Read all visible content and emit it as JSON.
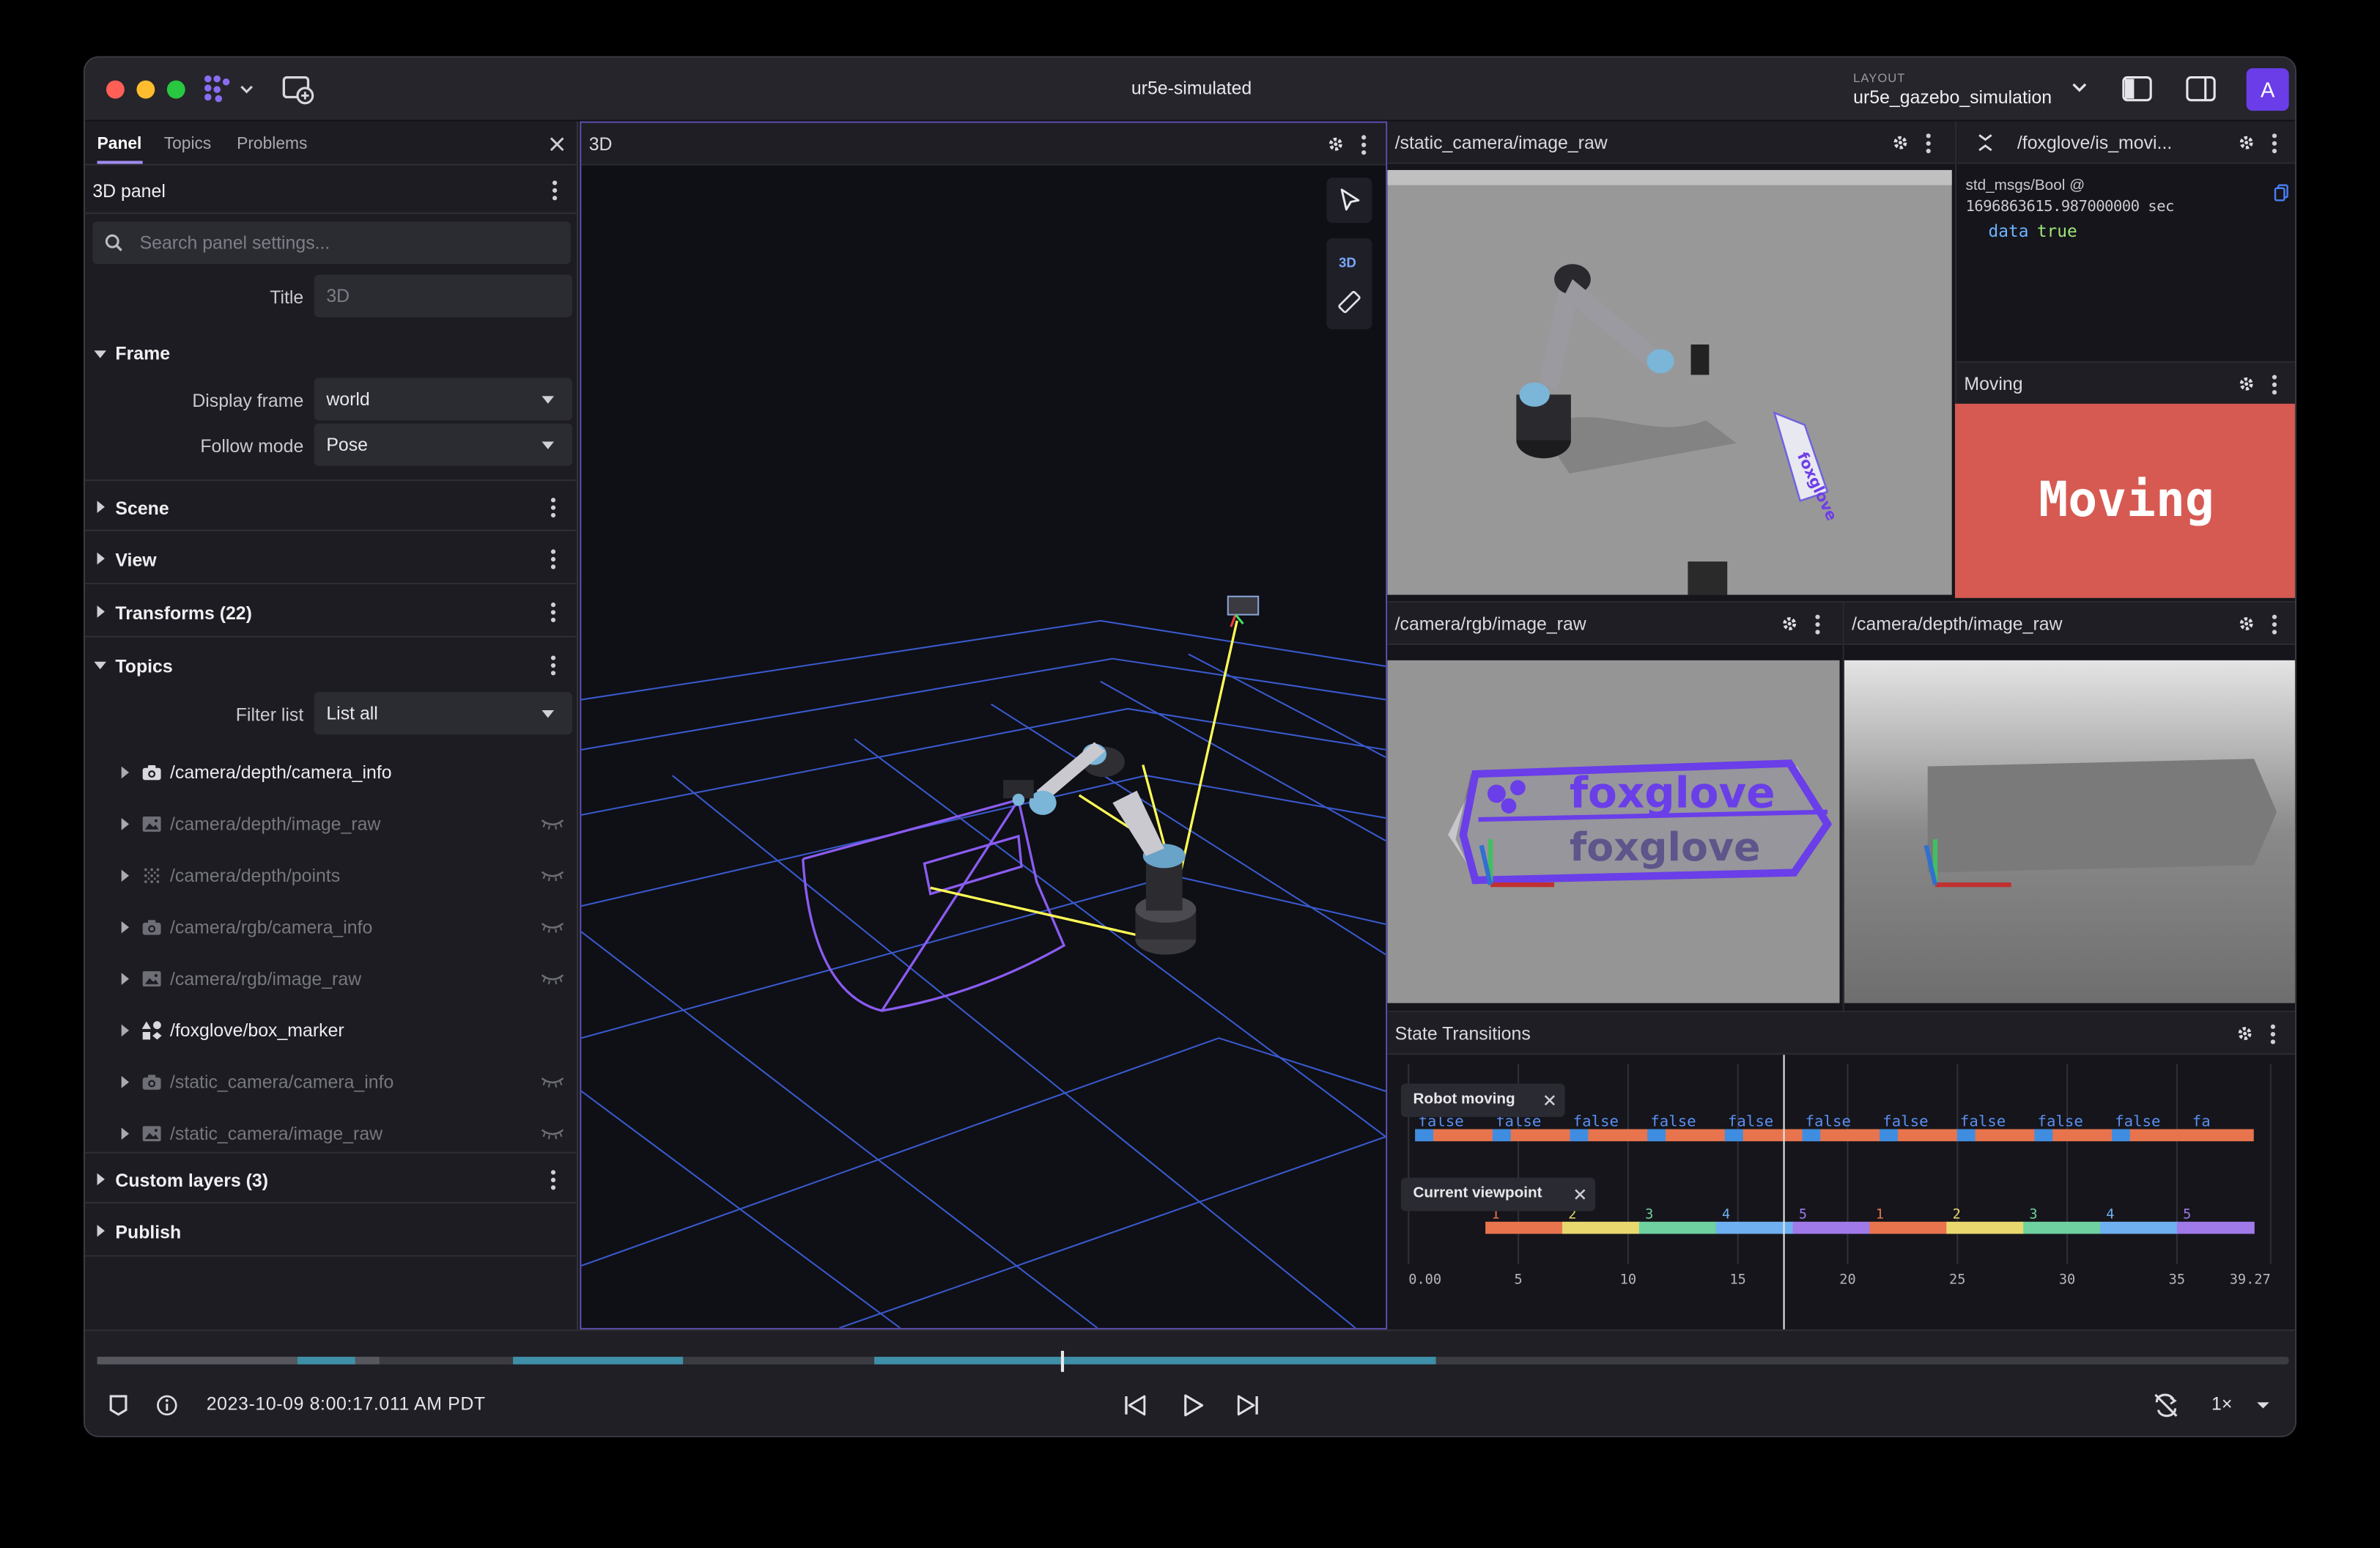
{
  "app": {
    "title": "ur5e-simulated",
    "layout_caption": "LAYOUT",
    "layout_name": "ur5e_gazebo_simulation",
    "avatar_letter": "A",
    "accent": "#6a3de8"
  },
  "sidebar": {
    "tabs": [
      "Panel",
      "Topics",
      "Problems"
    ],
    "panel_name": "3D panel",
    "search_placeholder": "Search panel settings...",
    "title_label": "Title",
    "title_placeholder": "3D",
    "sections": {
      "frame": "Frame",
      "scene": "Scene",
      "view": "View",
      "transforms": "Transforms (22)",
      "topics": "Topics",
      "custom_layers": "Custom layers (3)",
      "publish": "Publish"
    },
    "display_frame_label": "Display frame",
    "display_frame_value": "world",
    "follow_mode_label": "Follow mode",
    "follow_mode_value": "Pose",
    "filter_label": "Filter list",
    "filter_value": "List all",
    "topics": [
      {
        "name": "/camera/depth/camera_info",
        "icon": "camera-icon",
        "visible": true
      },
      {
        "name": "/camera/depth/image_raw",
        "icon": "image-icon",
        "visible": false
      },
      {
        "name": "/camera/depth/points",
        "icon": "points-icon",
        "visible": false
      },
      {
        "name": "/camera/rgb/camera_info",
        "icon": "camera-icon",
        "visible": false
      },
      {
        "name": "/camera/rgb/image_raw",
        "icon": "image-icon",
        "visible": false
      },
      {
        "name": "/foxglove/box_marker",
        "icon": "shapes-icon",
        "visible": true
      },
      {
        "name": "/static_camera/camera_info",
        "icon": "camera-icon",
        "visible": false
      },
      {
        "name": "/static_camera/image_raw",
        "icon": "image-icon",
        "visible": false
      }
    ]
  },
  "panels": {
    "three_d": {
      "title": "3D",
      "mode_label": "3D"
    },
    "static_camera": {
      "title": "/static_camera/image_raw"
    },
    "is_moving": {
      "title": "/foxglove/is_movi...",
      "message_type": "std_msgs/Bool @",
      "stamp": "1696863615.987000000 sec",
      "field": "data",
      "value": "true"
    },
    "moving": {
      "title": "Moving",
      "text": "Moving",
      "color": "#d65a52"
    },
    "rgb_camera": {
      "title": "/camera/rgb/image_raw",
      "box_text": "foxglove"
    },
    "depth_camera": {
      "title": "/camera/depth/image_raw"
    },
    "state_transitions": {
      "title": "State Transitions",
      "series": [
        {
          "name": "Robot moving",
          "labels": [
            "false",
            "false",
            "false",
            "false",
            "false",
            "false",
            "false",
            "false",
            "false",
            "false",
            "fa"
          ]
        },
        {
          "name": "Current viewpoint",
          "labels": [
            "1",
            "2",
            "3",
            "4",
            "5",
            "1",
            "2",
            "3",
            "4",
            "5"
          ]
        }
      ],
      "x_ticks": [
        "0.00",
        "5",
        "10",
        "15",
        "20",
        "25",
        "30",
        "35",
        "39.27"
      ]
    }
  },
  "playback": {
    "timestamp": "2023-10-09 8:00:17.011 AM PDT",
    "speed": "1×",
    "progress": 0.44
  }
}
